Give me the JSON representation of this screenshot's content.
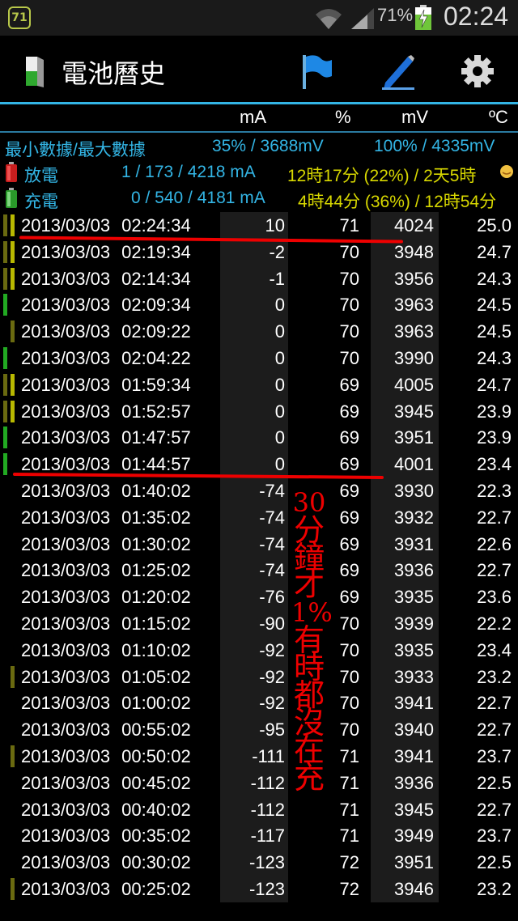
{
  "status_bar": {
    "notification_badge": "71",
    "battery_percent": "71%",
    "time": "02:24"
  },
  "app": {
    "title": "電池曆史"
  },
  "columns": {
    "ma": "mA",
    "pct": "%",
    "mv": "mV",
    "temp": "ºC"
  },
  "summary": {
    "minmax_label": "最小數據/最大數據",
    "min_value": "35% / 3688mV",
    "max_value": "100% / 4335mV",
    "discharge_label": "放電",
    "discharge_ma": "1 / 173 / 4218 mA",
    "discharge_time": "12時17分 (22%) / 2天5時",
    "charge_label": "充電",
    "charge_ma": "0 / 540 / 4181 mA",
    "charge_time": "4時44分 (36%) / 12時54分"
  },
  "rows": [
    {
      "date": "2013/03/03",
      "time": "02:24:34",
      "ma": "10",
      "pct": "71",
      "mv": "4024",
      "temp": "25.0",
      "ind": "yellow"
    },
    {
      "date": "2013/03/03",
      "time": "02:19:34",
      "ma": "-2",
      "pct": "70",
      "mv": "3948",
      "temp": "24.7",
      "ind": "yellow"
    },
    {
      "date": "2013/03/03",
      "time": "02:14:34",
      "ma": "-1",
      "pct": "70",
      "mv": "3956",
      "temp": "24.3",
      "ind": "yellow"
    },
    {
      "date": "2013/03/03",
      "time": "02:09:34",
      "ma": "0",
      "pct": "70",
      "mv": "3963",
      "temp": "24.5",
      "ind": "green"
    },
    {
      "date": "2013/03/03",
      "time": "02:09:22",
      "ma": "0",
      "pct": "70",
      "mv": "3963",
      "temp": "24.5",
      "ind": "olive"
    },
    {
      "date": "2013/03/03",
      "time": "02:04:22",
      "ma": "0",
      "pct": "70",
      "mv": "3990",
      "temp": "24.3",
      "ind": "green"
    },
    {
      "date": "2013/03/03",
      "time": "01:59:34",
      "ma": "0",
      "pct": "69",
      "mv": "4005",
      "temp": "24.7",
      "ind": "yellow"
    },
    {
      "date": "2013/03/03",
      "time": "01:52:57",
      "ma": "0",
      "pct": "69",
      "mv": "3945",
      "temp": "23.9",
      "ind": "yellow"
    },
    {
      "date": "2013/03/03",
      "time": "01:47:57",
      "ma": "0",
      "pct": "69",
      "mv": "3951",
      "temp": "23.9",
      "ind": "green"
    },
    {
      "date": "2013/03/03",
      "time": "01:44:57",
      "ma": "0",
      "pct": "69",
      "mv": "4001",
      "temp": "23.4",
      "ind": "green"
    },
    {
      "date": "2013/03/03",
      "time": "01:40:02",
      "ma": "-74",
      "pct": "69",
      "mv": "3930",
      "temp": "22.3",
      "ind": ""
    },
    {
      "date": "2013/03/03",
      "time": "01:35:02",
      "ma": "-74",
      "pct": "69",
      "mv": "3932",
      "temp": "22.7",
      "ind": ""
    },
    {
      "date": "2013/03/03",
      "time": "01:30:02",
      "ma": "-74",
      "pct": "69",
      "mv": "3931",
      "temp": "22.6",
      "ind": ""
    },
    {
      "date": "2013/03/03",
      "time": "01:25:02",
      "ma": "-74",
      "pct": "69",
      "mv": "3936",
      "temp": "22.7",
      "ind": ""
    },
    {
      "date": "2013/03/03",
      "time": "01:20:02",
      "ma": "-76",
      "pct": "69",
      "mv": "3935",
      "temp": "23.6",
      "ind": ""
    },
    {
      "date": "2013/03/03",
      "time": "01:15:02",
      "ma": "-90",
      "pct": "70",
      "mv": "3939",
      "temp": "22.2",
      "ind": ""
    },
    {
      "date": "2013/03/03",
      "time": "01:10:02",
      "ma": "-92",
      "pct": "70",
      "mv": "3935",
      "temp": "23.4",
      "ind": ""
    },
    {
      "date": "2013/03/03",
      "time": "01:05:02",
      "ma": "-92",
      "pct": "70",
      "mv": "3933",
      "temp": "23.2",
      "ind": "olive"
    },
    {
      "date": "2013/03/03",
      "time": "01:00:02",
      "ma": "-92",
      "pct": "70",
      "mv": "3941",
      "temp": "22.7",
      "ind": ""
    },
    {
      "date": "2013/03/03",
      "time": "00:55:02",
      "ma": "-95",
      "pct": "70",
      "mv": "3940",
      "temp": "22.7",
      "ind": ""
    },
    {
      "date": "2013/03/03",
      "time": "00:50:02",
      "ma": "-111",
      "pct": "71",
      "mv": "3941",
      "temp": "23.7",
      "ind": "olive"
    },
    {
      "date": "2013/03/03",
      "time": "00:45:02",
      "ma": "-112",
      "pct": "71",
      "mv": "3936",
      "temp": "22.5",
      "ind": ""
    },
    {
      "date": "2013/03/03",
      "time": "00:40:02",
      "ma": "-112",
      "pct": "71",
      "mv": "3945",
      "temp": "22.7",
      "ind": ""
    },
    {
      "date": "2013/03/03",
      "time": "00:35:02",
      "ma": "-117",
      "pct": "71",
      "mv": "3949",
      "temp": "23.7",
      "ind": ""
    },
    {
      "date": "2013/03/03",
      "time": "00:30:02",
      "ma": "-123",
      "pct": "72",
      "mv": "3951",
      "temp": "22.5",
      "ind": ""
    },
    {
      "date": "2013/03/03",
      "time": "00:25:02",
      "ma": "-123",
      "pct": "72",
      "mv": "3946",
      "temp": "23.2",
      "ind": "olive"
    }
  ],
  "indicator_colors": {
    "yellow": "#b8b800",
    "green": "#22aa22",
    "olive": "#6a6a10"
  },
  "annotation": {
    "chars": [
      "30",
      "分",
      "鐘",
      "才",
      "1%",
      "有",
      "時",
      "都",
      "沒",
      "在",
      "充"
    ]
  },
  "colors": {
    "accent": "#33b5e5",
    "summary_yellow": "#d8d800",
    "annotation_red": "#ee0000"
  }
}
